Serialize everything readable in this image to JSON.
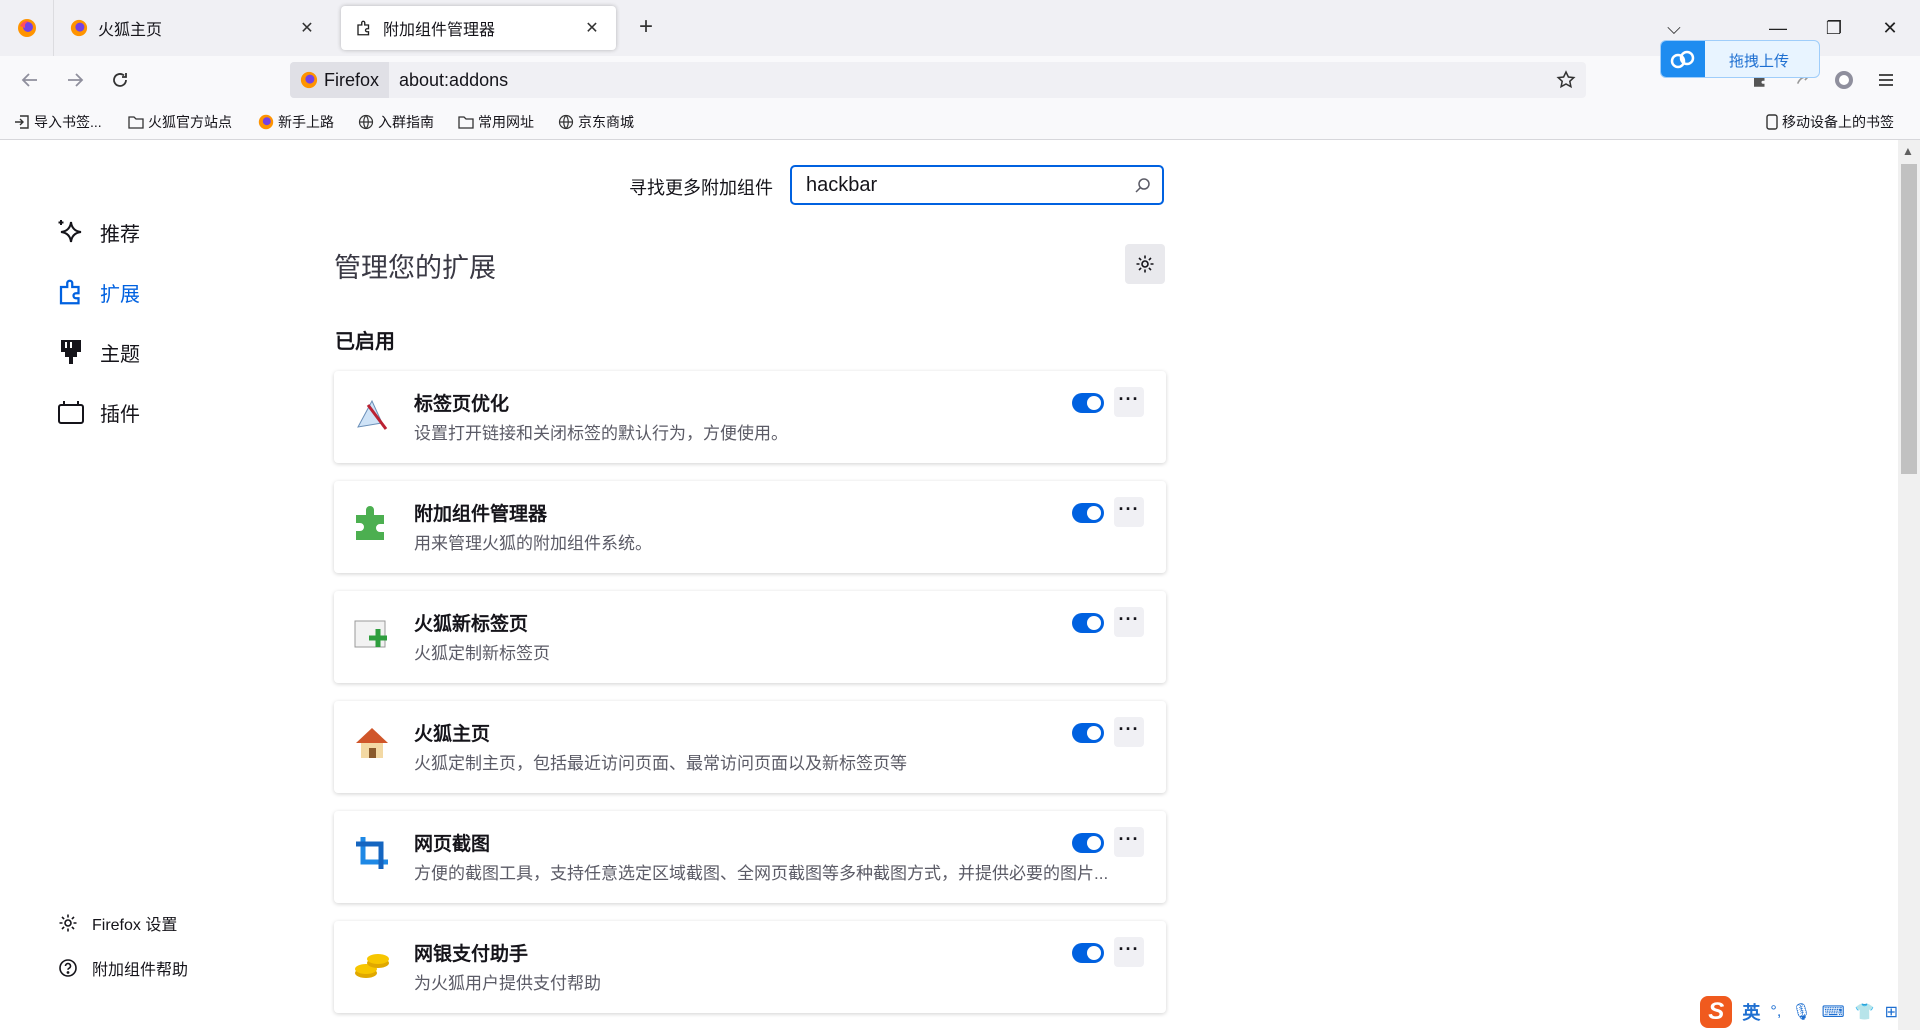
{
  "tabs": [
    {
      "title": "火狐主页"
    },
    {
      "title": "附加组件管理器",
      "active": true
    }
  ],
  "nav": {
    "identity": "Firefox",
    "url": "about:addons",
    "upload_label": "拖拽上传"
  },
  "bookmarks": [
    {
      "label": "导入书签...",
      "icon": "import-icon"
    },
    {
      "label": "火狐官方站点",
      "icon": "folder-icon"
    },
    {
      "label": "新手上路",
      "icon": "firefox-icon"
    },
    {
      "label": "入群指南",
      "icon": "globe-icon"
    },
    {
      "label": "常用网址",
      "icon": "folder-icon"
    },
    {
      "label": "京东商城",
      "icon": "globe-icon"
    }
  ],
  "mobile_bookmarks": "移动设备上的书签",
  "search": {
    "label": "寻找更多附加组件",
    "value": "hackbar"
  },
  "sidebar": {
    "items": [
      {
        "label": "推荐",
        "icon": "sparkle-icon"
      },
      {
        "label": "扩展",
        "icon": "puzzle-icon",
        "active": true
      },
      {
        "label": "主题",
        "icon": "brush-icon"
      },
      {
        "label": "插件",
        "icon": "plugin-icon"
      }
    ],
    "footer": [
      {
        "label": "Firefox 设置",
        "icon": "gear-icon"
      },
      {
        "label": "附加组件帮助",
        "icon": "help-icon"
      }
    ]
  },
  "main": {
    "heading": "管理您的扩展",
    "section": "已启用",
    "extensions": [
      {
        "name": "标签页优化",
        "desc": "设置打开链接和关闭标签的默认行为，方便使用。",
        "enabled": true
      },
      {
        "name": "附加组件管理器",
        "desc": "用来管理火狐的附加组件系统。",
        "enabled": true
      },
      {
        "name": "火狐新标签页",
        "desc": "火狐定制新标签页",
        "enabled": true
      },
      {
        "name": "火狐主页",
        "desc": "火狐定制主页，包括最近访问页面、最常访问页面以及新标签页等",
        "enabled": true
      },
      {
        "name": "网页截图",
        "desc": "方便的截图工具，支持任意选定区域截图、全网页截图等多种截图方式，并提供必要的图片...",
        "enabled": true
      },
      {
        "name": "网银支付助手",
        "desc": "为火狐用户提供支付帮助",
        "enabled": true
      }
    ]
  },
  "ime": {
    "lang": "英"
  },
  "colors": {
    "accent": "#0061e0",
    "ime": "#f05a1e",
    "upload": "#1e8cf0"
  }
}
